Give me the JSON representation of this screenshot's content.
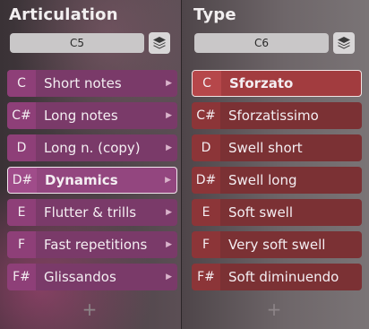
{
  "articulation": {
    "title": "Articulation",
    "note": "C5",
    "add_label": "+",
    "rows": [
      {
        "key": "C",
        "label": "Short notes"
      },
      {
        "key": "C#",
        "label": "Long notes"
      },
      {
        "key": "D",
        "label": "Long n. (copy)"
      },
      {
        "key": "D#",
        "label": "Dynamics"
      },
      {
        "key": "E",
        "label": "Flutter & trills"
      },
      {
        "key": "F",
        "label": "Fast repetitions"
      },
      {
        "key": "F#",
        "label": "Glissandos"
      }
    ],
    "selected_index": 3,
    "icons": {
      "stack": "layers-icon",
      "expand": "chevron-right-icon"
    }
  },
  "type": {
    "title": "Type",
    "note": "C6",
    "add_label": "+",
    "rows": [
      {
        "key": "C",
        "label": "Sforzato"
      },
      {
        "key": "C#",
        "label": "Sforzatissimo"
      },
      {
        "key": "D",
        "label": "Swell short"
      },
      {
        "key": "D#",
        "label": "Swell long"
      },
      {
        "key": "E",
        "label": "Soft swell"
      },
      {
        "key": "F",
        "label": "Very soft swell"
      },
      {
        "key": "F#",
        "label": "Soft diminuendo"
      }
    ],
    "selected_index": 0,
    "icons": {
      "stack": "layers-icon"
    }
  },
  "colors": {
    "articulation_row": "#7a3a69",
    "type_row": "#7b3134",
    "selected_border": "#f2e6ee"
  }
}
